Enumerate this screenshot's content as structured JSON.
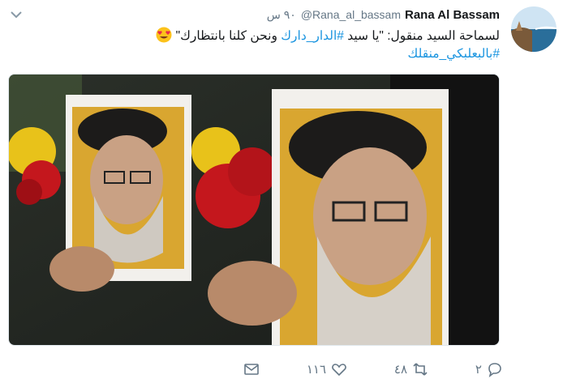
{
  "tweet": {
    "author_name": "Rana Al Bassam",
    "handle": "@Rana_al_bassam",
    "time": "٩٠ س",
    "text_prefix": "لسماحة السيد منقول: \"يا سيد ",
    "hashtag_1": "#الدار_دارك",
    "text_suffix": " ونحن كلنا بانتظارك\"",
    "hashtag_2": "#بالبعلبكي_منقلك",
    "emoji": "heart-eyes-emoji"
  },
  "actions": {
    "reply_count": "٢",
    "retweet_count": "٤٨",
    "like_count": "١١٦"
  },
  "colors": {
    "link": "#1b95e0",
    "muted": "#657786",
    "text": "#14171a"
  },
  "icons": [
    "chevron-down-icon",
    "reply-icon",
    "retweet-icon",
    "like-icon",
    "message-icon"
  ]
}
